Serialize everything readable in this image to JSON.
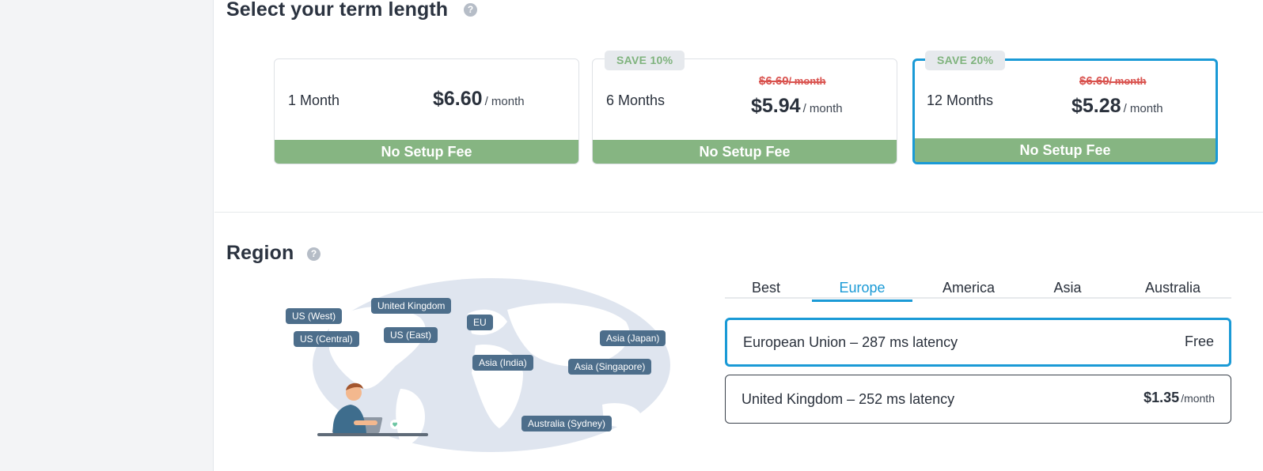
{
  "term": {
    "title": "Select your term length",
    "help": "?",
    "options": [
      {
        "label": "1 Month",
        "price": "$6.60",
        "unit": "/ month",
        "old_price": "",
        "old_unit": "",
        "badge": "",
        "fee": "No Setup Fee",
        "selected": false
      },
      {
        "label": "6 Months",
        "price": "$5.94",
        "unit": "/ month",
        "old_price": "$6.60",
        "old_unit": "/ month",
        "badge": "SAVE 10%",
        "fee": "No Setup Fee",
        "selected": false
      },
      {
        "label": "12 Months",
        "price": "$5.28",
        "unit": "/ month",
        "old_price": "$6.60",
        "old_unit": "/ month",
        "badge": "SAVE 20%",
        "fee": "No Setup Fee",
        "selected": true
      }
    ]
  },
  "region": {
    "title": "Region",
    "help": "?",
    "map_tags": [
      "US (West)",
      "United Kingdom",
      "EU",
      "US (Central)",
      "US (East)",
      "Asia (Japan)",
      "Asia (India)",
      "Asia (Singapore)",
      "Australia (Sydney)"
    ],
    "tabs": [
      "Best",
      "Europe",
      "America",
      "Asia",
      "Australia"
    ],
    "active_tab": "Europe",
    "options": [
      {
        "label": "European Union – 287 ms latency",
        "price": "Free",
        "per": "",
        "selected": true
      },
      {
        "label": "United Kingdom – 252 ms latency",
        "price": "$1.35",
        "per": "/month",
        "selected": false
      }
    ]
  },
  "colors": {
    "accent": "#1a9ad6",
    "fee_green": "#86b582",
    "badge_text": "#7fb37d",
    "strike_red": "#d9534f",
    "map_tag": "#4d6e8b"
  }
}
